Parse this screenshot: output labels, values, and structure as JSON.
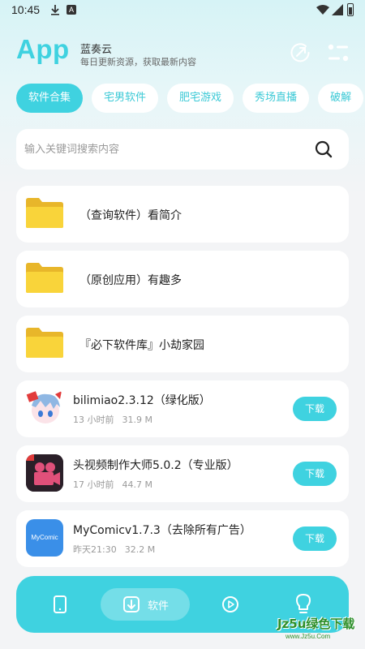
{
  "status_bar": {
    "time": "10:45",
    "notif_a": "A"
  },
  "header": {
    "logo": "App",
    "title": "蓝奏云",
    "subtitle": "每日更新资源，获取最新内容"
  },
  "tabs": [
    {
      "label": "软件合集",
      "active": true
    },
    {
      "label": "宅男软件"
    },
    {
      "label": "肥宅游戏"
    },
    {
      "label": "秀场直播"
    },
    {
      "label": "破解"
    }
  ],
  "search": {
    "placeholder": "输入关键词搜索内容"
  },
  "folders": [
    {
      "title": "（查询软件）看简介"
    },
    {
      "title": "（原创应用）有趣多"
    },
    {
      "title": "『必下软件库』小劫家园"
    }
  ],
  "apps": [
    {
      "name": "bilimiao2.3.12（绿化版）",
      "time": "13 小时前",
      "size": "31.9 M",
      "button": "下载",
      "icon": "bilimiao-icon"
    },
    {
      "name": "头视频制作大师5.0.2（专业版）",
      "time": "17 小时前",
      "size": "44.7 M",
      "button": "下载",
      "icon": "video-maker-icon"
    },
    {
      "name": "MyComicv1.7.3（去除所有广告）",
      "time": "昨天21:30",
      "size": "32.2 M",
      "button": "下载",
      "icon": "mycomic-icon",
      "icon_text": "MyComic"
    }
  ],
  "bottom_nav": {
    "items": [
      {
        "icon": "phone-icon"
      },
      {
        "icon": "download-icon",
        "label": "软件",
        "active": true
      },
      {
        "icon": "play-icon"
      },
      {
        "icon": "lightbulb-icon"
      }
    ]
  },
  "watermark": {
    "brand": "Jz5u绿色下载",
    "url": "www.Jz5u.Com"
  },
  "colors": {
    "accent": "#3fd2e0",
    "background": "#f3f4f6",
    "folder": "#f7cf2e"
  }
}
